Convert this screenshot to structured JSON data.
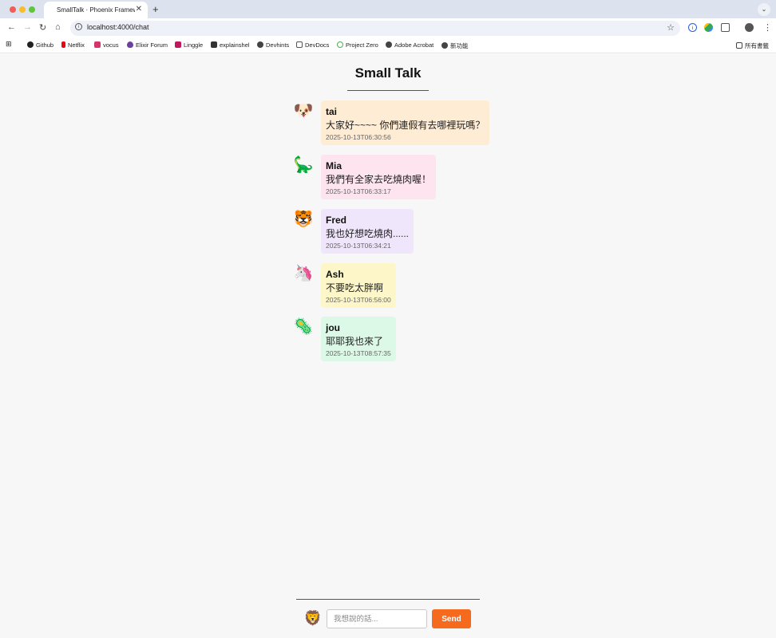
{
  "browser": {
    "tab_title": "SmallTalk · Phoenix Framework",
    "tab_close": "✕",
    "new_tab": "+",
    "url": "localhost:4000/chat",
    "bookmarks": [
      {
        "label": "Github",
        "color": "#222222"
      },
      {
        "label": "Netflix",
        "color": "#e50914"
      },
      {
        "label": "vocus",
        "color": "#d6336c"
      },
      {
        "label": "Elixir Forum",
        "color": "#6b3fa0"
      },
      {
        "label": "Linggle",
        "color": "#c2185b"
      },
      {
        "label": "explainshel",
        "color": "#333333"
      },
      {
        "label": "Devhints",
        "color": "#444444"
      },
      {
        "label": "DevDocs",
        "color": "#555555"
      },
      {
        "label": "Project Zero",
        "color": "#4caf50"
      },
      {
        "label": "Adobe Acrobat",
        "color": "#444444"
      },
      {
        "label": "新功能",
        "color": "#444444"
      }
    ],
    "bookmarks_folder": "所有書籤"
  },
  "chat": {
    "title": "Small Talk",
    "messages": [
      {
        "name": "tai",
        "avatar": "🐶",
        "text": "大家好~~~~ 你們連假有去哪裡玩嗎？",
        "time": "2025-10-13T06:30:56",
        "color": "#ffecd4"
      },
      {
        "name": "Mia",
        "avatar": "🦕",
        "text": "我們有全家去吃燒肉喔！",
        "time": "2025-10-13T06:33:17",
        "color": "#fde4ee"
      },
      {
        "name": "Fred",
        "avatar": "🐯",
        "text": "我也好想吃燒肉......",
        "time": "2025-10-13T06:34:21",
        "color": "#efe6fc"
      },
      {
        "name": "Ash",
        "avatar": "🦄",
        "text": "不要吃太胖啊",
        "time": "2025-10-13T06:56:00",
        "color": "#fdf6c8"
      },
      {
        "name": "jou",
        "avatar": "🦠",
        "text": "耶耶我也來了",
        "time": "2025-10-13T08:57:35",
        "color": "#dcf8e6"
      }
    ],
    "composer": {
      "avatar": "🦁",
      "placeholder": "我想說的話...",
      "send_label": "Send",
      "send_color": "#f56a1d"
    }
  }
}
